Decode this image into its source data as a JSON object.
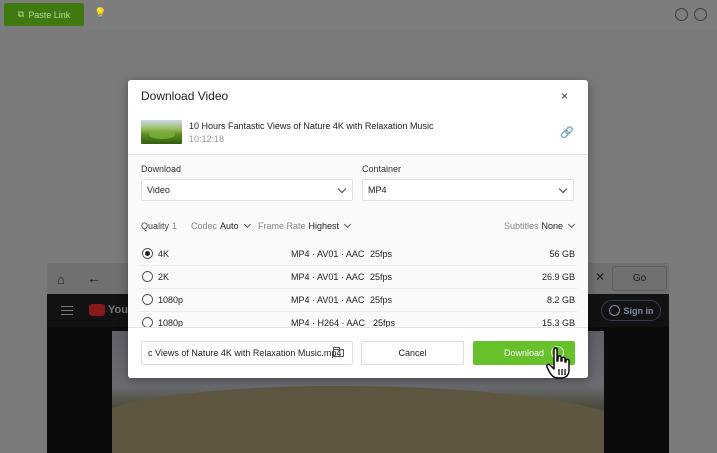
{
  "app": {
    "paste_link_label": "Paste Link"
  },
  "browser": {
    "go_label": "Go",
    "youtube_logo_text": "YouTube",
    "sign_in_label": "Sign in"
  },
  "dialog": {
    "title": "Download Video",
    "close_glyph": "×",
    "video": {
      "title": "10 Hours Fantastic Views of Nature 4K with Relaxation Music",
      "duration": "10:12:18"
    },
    "download_label": "Download",
    "download_value": "Video",
    "container_label": "Container",
    "container_value": "MP4",
    "options": {
      "quality_label": "Quality",
      "quality_value": "1",
      "codec_label": "Codec",
      "codec_value": "Auto",
      "framerate_label": "Frame Rate",
      "framerate_value": "Highest",
      "subtitles_label": "Subtitles",
      "subtitles_value": "None"
    },
    "formats": [
      {
        "quality": "4K",
        "format": "MP4 · AV01 · AAC",
        "fps": "25fps",
        "size": "56 GB",
        "selected": true
      },
      {
        "quality": "2K",
        "format": "MP4 · AV01 · AAC",
        "fps": "25fps",
        "size": "26.9 GB",
        "selected": false
      },
      {
        "quality": "1080p",
        "format": "MP4 · AV01 · AAC",
        "fps": "25fps",
        "size": "8.2 GB",
        "selected": false
      },
      {
        "quality": "1080p",
        "format": "MP4 · H264 · AAC",
        "fps": "25fps",
        "size": "15.3 GB",
        "selected": false
      }
    ],
    "filename": "c Views of Nature 4K with Relaxation Music.mp4",
    "cancel_label": "Cancel",
    "download_button_label": "Download"
  },
  "colors": {
    "accent_green": "#67c12a",
    "paste_button_dimmed": "#3f7a10"
  },
  "icons": [
    "paste-icon",
    "bulb-icon",
    "settings-icon",
    "account-icon",
    "home-icon",
    "back-icon",
    "close-icon",
    "link-icon",
    "folder-icon",
    "download-icon",
    "hand-cursor-icon"
  ]
}
